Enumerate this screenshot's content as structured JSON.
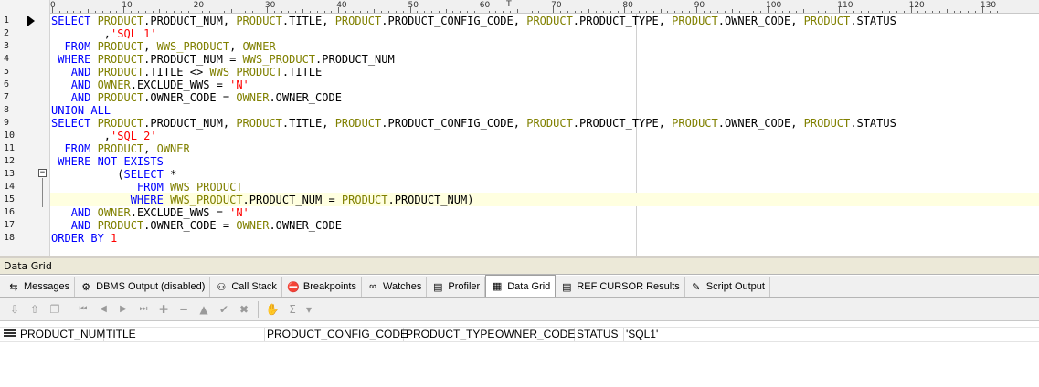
{
  "editor": {
    "ruler_labels": [
      "0",
      "10",
      "20",
      "30",
      "40",
      "50",
      "60",
      "70",
      "80",
      "90",
      "100",
      "110",
      "120",
      "130"
    ],
    "line_numbers": [
      "1",
      "2",
      "3",
      "4",
      "5",
      "6",
      "7",
      "8",
      "9",
      "10",
      "11",
      "12",
      "13",
      "14",
      "15",
      "16",
      "17",
      "18"
    ],
    "current_line": 15,
    "lines": [
      [
        [
          "kw",
          "SELECT "
        ],
        [
          "id",
          "PRODUCT"
        ],
        [
          "txt",
          ".PRODUCT_NUM, "
        ],
        [
          "id",
          "PRODUCT"
        ],
        [
          "txt",
          ".TITLE, "
        ],
        [
          "id",
          "PRODUCT"
        ],
        [
          "txt",
          ".PRODUCT_CONFIG_CODE, "
        ],
        [
          "id",
          "PRODUCT"
        ],
        [
          "txt",
          ".PRODUCT_TYPE, "
        ],
        [
          "id",
          "PRODUCT"
        ],
        [
          "txt",
          ".OWNER_CODE, "
        ],
        [
          "id",
          "PRODUCT"
        ],
        [
          "txt",
          ".STATUS"
        ]
      ],
      [
        [
          "txt",
          "        ,"
        ],
        [
          "str",
          "'SQL 1'"
        ]
      ],
      [
        [
          "txt",
          "  "
        ],
        [
          "kw",
          "FROM "
        ],
        [
          "id",
          "PRODUCT"
        ],
        [
          "txt",
          ", "
        ],
        [
          "id",
          "WWS_PRODUCT"
        ],
        [
          "txt",
          ", "
        ],
        [
          "id",
          "OWNER"
        ]
      ],
      [
        [
          "txt",
          " "
        ],
        [
          "kw",
          "WHERE "
        ],
        [
          "id",
          "PRODUCT"
        ],
        [
          "txt",
          ".PRODUCT_NUM = "
        ],
        [
          "id",
          "WWS_PRODUCT"
        ],
        [
          "txt",
          ".PRODUCT_NUM"
        ]
      ],
      [
        [
          "txt",
          "   "
        ],
        [
          "kw",
          "AND "
        ],
        [
          "id",
          "PRODUCT"
        ],
        [
          "txt",
          ".TITLE <> "
        ],
        [
          "id",
          "WWS_PRODUCT"
        ],
        [
          "txt",
          ".TITLE"
        ]
      ],
      [
        [
          "txt",
          "   "
        ],
        [
          "kw",
          "AND "
        ],
        [
          "id",
          "OWNER"
        ],
        [
          "txt",
          ".EXCLUDE_WWS = "
        ],
        [
          "str",
          "'N'"
        ]
      ],
      [
        [
          "txt",
          "   "
        ],
        [
          "kw",
          "AND "
        ],
        [
          "id",
          "PRODUCT"
        ],
        [
          "txt",
          ".OWNER_CODE = "
        ],
        [
          "id",
          "OWNER"
        ],
        [
          "txt",
          ".OWNER_CODE"
        ]
      ],
      [
        [
          "kw",
          "UNION ALL"
        ]
      ],
      [
        [
          "kw",
          "SELECT "
        ],
        [
          "id",
          "PRODUCT"
        ],
        [
          "txt",
          ".PRODUCT_NUM, "
        ],
        [
          "id",
          "PRODUCT"
        ],
        [
          "txt",
          ".TITLE, "
        ],
        [
          "id",
          "PRODUCT"
        ],
        [
          "txt",
          ".PRODUCT_CONFIG_CODE, "
        ],
        [
          "id",
          "PRODUCT"
        ],
        [
          "txt",
          ".PRODUCT_TYPE, "
        ],
        [
          "id",
          "PRODUCT"
        ],
        [
          "txt",
          ".OWNER_CODE, "
        ],
        [
          "id",
          "PRODUCT"
        ],
        [
          "txt",
          ".STATUS"
        ]
      ],
      [
        [
          "txt",
          "        ,"
        ],
        [
          "str",
          "'SQL 2'"
        ]
      ],
      [
        [
          "txt",
          "  "
        ],
        [
          "kw",
          "FROM "
        ],
        [
          "id",
          "PRODUCT"
        ],
        [
          "txt",
          ", "
        ],
        [
          "id",
          "OWNER"
        ]
      ],
      [
        [
          "txt",
          " "
        ],
        [
          "kw",
          "WHERE NOT EXISTS"
        ]
      ],
      [
        [
          "txt",
          "          ("
        ],
        [
          "kw",
          "SELECT "
        ],
        [
          "txt",
          "*"
        ]
      ],
      [
        [
          "txt",
          "             "
        ],
        [
          "kw",
          "FROM "
        ],
        [
          "id",
          "WWS_PRODUCT"
        ]
      ],
      [
        [
          "txt",
          "            "
        ],
        [
          "kw",
          "WHERE "
        ],
        [
          "id",
          "WWS_PRODUCT"
        ],
        [
          "txt",
          ".PRODUCT_NUM = "
        ],
        [
          "id",
          "PRODUCT"
        ],
        [
          "txt",
          ".PRODUCT_NUM)"
        ]
      ],
      [
        [
          "txt",
          "   "
        ],
        [
          "kw",
          "AND "
        ],
        [
          "id",
          "OWNER"
        ],
        [
          "txt",
          ".EXCLUDE_WWS = "
        ],
        [
          "str",
          "'N'"
        ]
      ],
      [
        [
          "txt",
          "   "
        ],
        [
          "kw",
          "AND "
        ],
        [
          "id",
          "PRODUCT"
        ],
        [
          "txt",
          ".OWNER_CODE = "
        ],
        [
          "id",
          "OWNER"
        ],
        [
          "txt",
          ".OWNER_CODE"
        ]
      ],
      [
        [
          "kw",
          "ORDER BY "
        ],
        [
          "num",
          "1"
        ]
      ]
    ]
  },
  "panel": {
    "title": "Data Grid",
    "tabs": [
      {
        "label": "Messages",
        "icon": "messages-icon"
      },
      {
        "label": "DBMS Output (disabled)",
        "icon": "dbms-output-icon"
      },
      {
        "label": "Call Stack",
        "icon": "call-stack-icon"
      },
      {
        "label": "Breakpoints",
        "icon": "breakpoints-icon"
      },
      {
        "label": "Watches",
        "icon": "watches-icon"
      },
      {
        "label": "Profiler",
        "icon": "profiler-icon"
      },
      {
        "label": "Data Grid",
        "icon": "data-grid-icon",
        "active": true
      },
      {
        "label": "REF CURSOR Results",
        "icon": "ref-cursor-icon"
      },
      {
        "label": "Script Output",
        "icon": "script-output-icon"
      }
    ],
    "toolbar_icons": [
      "export-icon",
      "import-icon",
      "copy-icon",
      "first-record-icon",
      "prior-record-icon",
      "next-record-icon",
      "last-record-icon",
      "insert-record-icon",
      "delete-record-icon",
      "edit-record-icon",
      "post-edit-icon",
      "cancel-edit-icon",
      "hand-icon",
      "sum-icon",
      "dropdown-icon"
    ]
  },
  "grid": {
    "columns": [
      "PRODUCT_NUM",
      "TITLE",
      "PRODUCT_CONFIG_CODE",
      "PRODUCT_TYPE",
      "OWNER_CODE",
      "STATUS",
      "'SQL1'"
    ]
  },
  "colors": {
    "keyword": "#0000ff",
    "identifier": "#808000",
    "string": "#ff0000",
    "current_line": "#ffffe0"
  }
}
